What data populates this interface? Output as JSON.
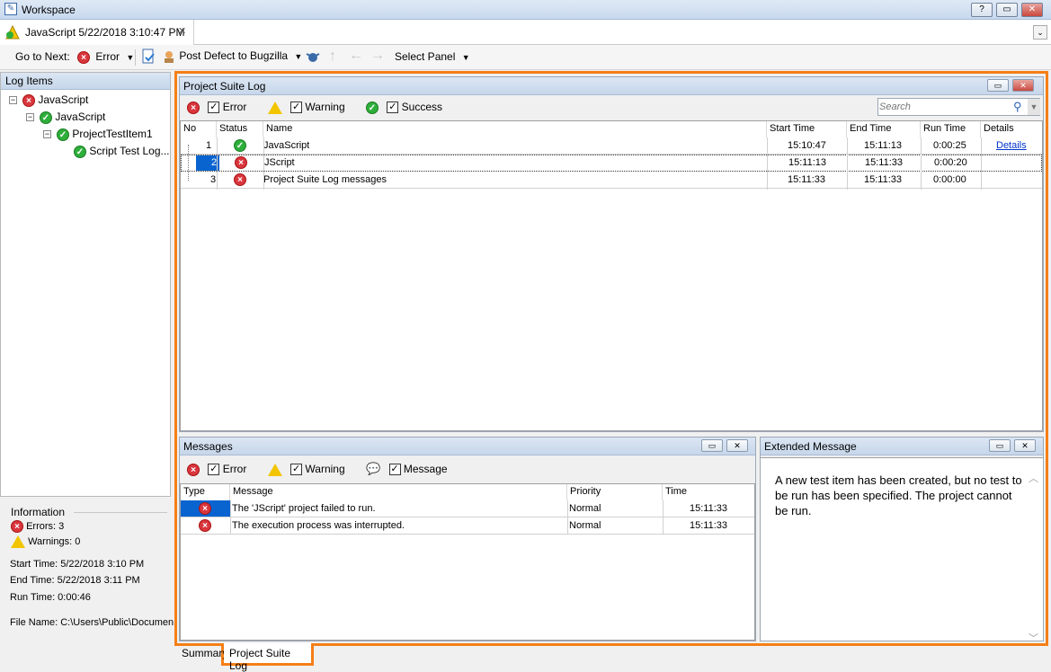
{
  "window": {
    "title": "Workspace",
    "help": "?",
    "restore": "▭",
    "close": "✕"
  },
  "doc_tab": {
    "label": "JavaScript 5/22/2018 3:10:47 PM",
    "close": "✕"
  },
  "toolbar": {
    "goto_label": "Go to Next:",
    "goto_value": "Error",
    "post_defect": "Post Defect to Bugzilla",
    "select_panel": "Select Panel"
  },
  "log_items": {
    "title": "Log Items",
    "items": [
      {
        "label": "JavaScript",
        "status": "error"
      },
      {
        "label": "JavaScript",
        "status": "success"
      },
      {
        "label": "ProjectTestItem1",
        "status": "success"
      },
      {
        "label": "Script Test Log...",
        "status": "success"
      }
    ]
  },
  "info": {
    "title": "Information",
    "errors": "Errors: 3",
    "warnings": "Warnings: 0",
    "start": "Start Time: 5/22/2018 3:10 PM",
    "end": "End Time: 5/22/2018 3:11 PM",
    "run": "Run Time: 0:00:46",
    "file": "File Name: C:\\Users\\Public\\Documen"
  },
  "suite_log": {
    "title": "Project Suite Log",
    "filters": {
      "error": "Error",
      "warning": "Warning",
      "success": "Success"
    },
    "search_placeholder": "Search",
    "columns": [
      "No",
      "Status",
      "Name",
      "Start Time",
      "End Time",
      "Run Time",
      "Details"
    ],
    "rows": [
      {
        "no": "1",
        "status": "success",
        "name": "JavaScript",
        "start": "15:10:47",
        "end": "15:11:13",
        "run": "0:00:25",
        "details": "Details"
      },
      {
        "no": "2",
        "status": "error",
        "name": "JScript",
        "start": "15:11:13",
        "end": "15:11:33",
        "run": "0:00:20",
        "details": ""
      },
      {
        "no": "3",
        "status": "error",
        "name": "Project Suite Log messages",
        "start": "15:11:33",
        "end": "15:11:33",
        "run": "0:00:00",
        "details": ""
      }
    ]
  },
  "messages": {
    "title": "Messages",
    "filters": {
      "error": "Error",
      "warning": "Warning",
      "message": "Message"
    },
    "columns": [
      "Type",
      "Message",
      "Priority",
      "Time"
    ],
    "rows": [
      {
        "message": "The 'JScript' project failed to run.",
        "priority": "Normal",
        "time": "15:11:33"
      },
      {
        "message": "The execution process was interrupted.",
        "priority": "Normal",
        "time": "15:11:33"
      }
    ]
  },
  "extended": {
    "title": "Extended Message",
    "text": "A new test item has been created, but no test to be run has been specified. The project cannot be run."
  },
  "bottom_tabs": [
    "Summary",
    "Project Suite Log"
  ],
  "colors": {
    "accent_orange": "#f57f17",
    "selection_blue": "#0a64d0",
    "link": "#0033cc"
  }
}
